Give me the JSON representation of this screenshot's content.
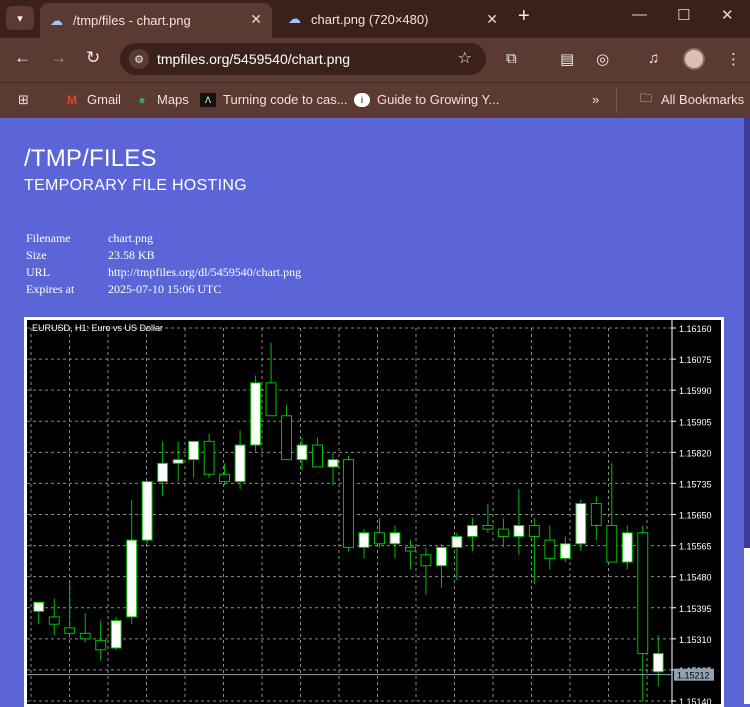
{
  "browser": {
    "tabs": [
      {
        "title": "/tmp/files - chart.png",
        "icon": "cloud-upload-icon"
      },
      {
        "title": "chart.png (720×480)",
        "icon": "cloud-upload-icon"
      }
    ],
    "url": "tmpfiles.org/5459540/chart.png",
    "bookmarks": [
      {
        "label": "Gmail",
        "icon": "gmail-icon"
      },
      {
        "label": "Maps",
        "icon": "maps-icon"
      },
      {
        "label": "Turning code to cas...",
        "icon": "site-icon"
      },
      {
        "label": "Guide to Growing Y...",
        "icon": "site-icon"
      },
      {
        "label": "All Bookmarks",
        "icon": "folder-icon"
      }
    ]
  },
  "page": {
    "title": "/TMP/FILES",
    "subtitle": "TEMPORARY FILE HOSTING",
    "meta": [
      {
        "key": "Filename",
        "value": "chart.png"
      },
      {
        "key": "Size",
        "value": "23.58 KB"
      },
      {
        "key": "URL",
        "value": "http://tmpfiles.org/dl/5459540/chart.png"
      },
      {
        "key": "Expires at",
        "value": "2025-07-10 15:06 UTC"
      }
    ]
  },
  "chart_data": {
    "type": "candlestick",
    "title": "EURUSD, H1:  Euro vs US Dollar",
    "ylim": [
      1.1514,
      1.1616
    ],
    "yticks": [
      "1.16160",
      "1.16075",
      "1.15990",
      "1.15905",
      "1.15820",
      "1.15735",
      "1.15650",
      "1.15565",
      "1.15480",
      "1.15395",
      "1.15310",
      "1.15225",
      "1.15140"
    ],
    "current_price": "1.15212",
    "grid": true,
    "colors": {
      "background": "#000000",
      "bull": "#ffffff",
      "bear": "#000000",
      "wick": "#00c000",
      "grid": "#8a8a8a",
      "text": "#ffffff"
    },
    "candles": [
      {
        "o": 1.15385,
        "h": 1.1541,
        "l": 1.1535,
        "c": 1.1541
      },
      {
        "o": 1.1537,
        "h": 1.1542,
        "l": 1.1532,
        "c": 1.1535
      },
      {
        "o": 1.1534,
        "h": 1.1547,
        "l": 1.1532,
        "c": 1.15325
      },
      {
        "o": 1.15325,
        "h": 1.1538,
        "l": 1.153,
        "c": 1.1531
      },
      {
        "o": 1.15305,
        "h": 1.1536,
        "l": 1.1525,
        "c": 1.1528
      },
      {
        "o": 1.15285,
        "h": 1.1537,
        "l": 1.1528,
        "c": 1.1536
      },
      {
        "o": 1.1537,
        "h": 1.1569,
        "l": 1.1535,
        "c": 1.1558
      },
      {
        "o": 1.1558,
        "h": 1.1571,
        "l": 1.1557,
        "c": 1.1574
      },
      {
        "o": 1.1574,
        "h": 1.1585,
        "l": 1.157,
        "c": 1.1579
      },
      {
        "o": 1.1579,
        "h": 1.1585,
        "l": 1.1574,
        "c": 1.158
      },
      {
        "o": 1.158,
        "h": 1.1585,
        "l": 1.1575,
        "c": 1.1585
      },
      {
        "o": 1.1585,
        "h": 1.1587,
        "l": 1.1575,
        "c": 1.1576
      },
      {
        "o": 1.1576,
        "h": 1.1579,
        "l": 1.1573,
        "c": 1.1574
      },
      {
        "o": 1.1574,
        "h": 1.1588,
        "l": 1.1572,
        "c": 1.1584
      },
      {
        "o": 1.1584,
        "h": 1.1603,
        "l": 1.1582,
        "c": 1.1601
      },
      {
        "o": 1.1601,
        "h": 1.1612,
        "l": 1.1592,
        "c": 1.1592
      },
      {
        "o": 1.1592,
        "h": 1.1595,
        "l": 1.158,
        "c": 1.158
      },
      {
        "o": 1.158,
        "h": 1.1586,
        "l": 1.1577,
        "c": 1.1584
      },
      {
        "o": 1.1584,
        "h": 1.1586,
        "l": 1.1578,
        "c": 1.1578
      },
      {
        "o": 1.1578,
        "h": 1.1582,
        "l": 1.1573,
        "c": 1.158
      },
      {
        "o": 1.158,
        "h": 1.1581,
        "l": 1.1555,
        "c": 1.1556
      },
      {
        "o": 1.1556,
        "h": 1.1561,
        "l": 1.1553,
        "c": 1.156
      },
      {
        "o": 1.156,
        "h": 1.1564,
        "l": 1.1556,
        "c": 1.1557
      },
      {
        "o": 1.1557,
        "h": 1.1562,
        "l": 1.1553,
        "c": 1.156
      },
      {
        "o": 1.1556,
        "h": 1.1558,
        "l": 1.155,
        "c": 1.1555
      },
      {
        "o": 1.1554,
        "h": 1.1556,
        "l": 1.1543,
        "c": 1.1551
      },
      {
        "o": 1.1551,
        "h": 1.1557,
        "l": 1.1545,
        "c": 1.1556
      },
      {
        "o": 1.1556,
        "h": 1.156,
        "l": 1.1547,
        "c": 1.1559
      },
      {
        "o": 1.1559,
        "h": 1.1564,
        "l": 1.1555,
        "c": 1.1562
      },
      {
        "o": 1.1562,
        "h": 1.1568,
        "l": 1.156,
        "c": 1.1561
      },
      {
        "o": 1.1561,
        "h": 1.1564,
        "l": 1.1556,
        "c": 1.1559
      },
      {
        "o": 1.1559,
        "h": 1.1572,
        "l": 1.1554,
        "c": 1.1562
      },
      {
        "o": 1.1562,
        "h": 1.1564,
        "l": 1.1546,
        "c": 1.1559
      },
      {
        "o": 1.1558,
        "h": 1.1562,
        "l": 1.155,
        "c": 1.1553
      },
      {
        "o": 1.1553,
        "h": 1.1559,
        "l": 1.1552,
        "c": 1.1557
      },
      {
        "o": 1.1557,
        "h": 1.1569,
        "l": 1.1555,
        "c": 1.1568
      },
      {
        "o": 1.1568,
        "h": 1.157,
        "l": 1.1558,
        "c": 1.1562
      },
      {
        "o": 1.1562,
        "h": 1.1579,
        "l": 1.1552,
        "c": 1.1552
      },
      {
        "o": 1.1552,
        "h": 1.1562,
        "l": 1.155,
        "c": 1.156
      },
      {
        "o": 1.156,
        "h": 1.1562,
        "l": 1.1514,
        "c": 1.1527
      },
      {
        "o": 1.1522,
        "h": 1.1532,
        "l": 1.1518,
        "c": 1.1527
      }
    ]
  }
}
